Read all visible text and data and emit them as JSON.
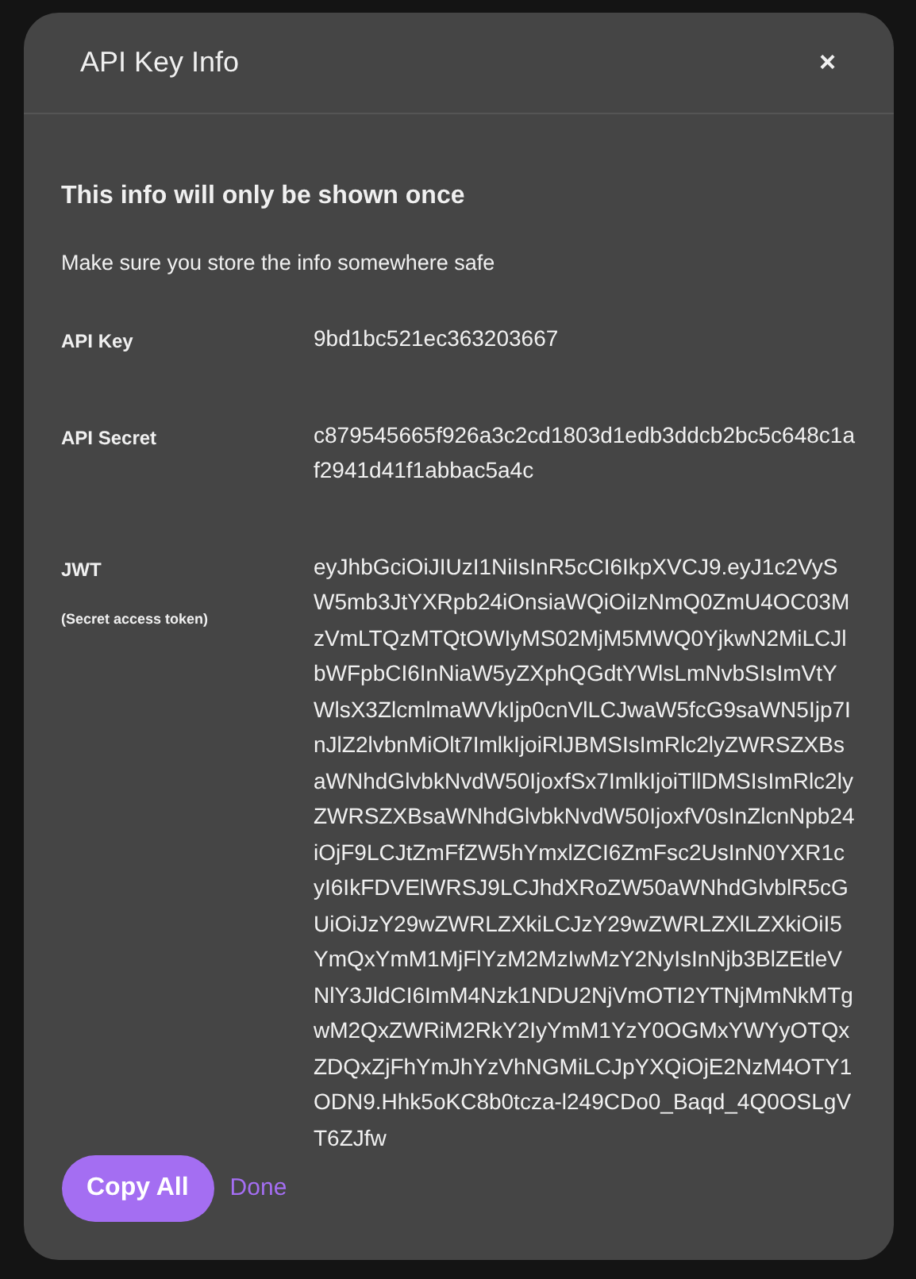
{
  "dialog": {
    "title": "API Key Info",
    "close": "×"
  },
  "heading": "This info will only be shown once",
  "subtitle": "Make sure you store the info somewhere safe",
  "fields": [
    {
      "label": "API Key",
      "value": "9bd1bc521ec363203667"
    },
    {
      "label": "API Secret",
      "value": "c879545665f926a3c2cd1803d1edb3ddcb2bc5c648c1af2941d41f1abbac5a4c"
    },
    {
      "label": "JWT",
      "note": "(Secret access token)",
      "value": "eyJhbGciOiJIUzI1NiIsInR5cCI6IkpXVCJ9.eyJ1c2VySW5mb3JtYXRpb24iOnsiaWQiOiIzNmQ0ZmU4OC03MzVmLTQzMTQtOWIyMS02MjM5MWQ0YjkwN2MiLCJlbWFpbCI6InNiaW5yZXphQGdtYWlsLmNvbSIsImVtYWlsX3ZlcmlmaWVkIjp0cnVlLCJwaW5fcG9saWN5Ijp7InJlZ2lvbnMiOlt7ImlkIjoiRlJBMSIsImRlc2lyZWRSZXBsaWNhdGlvbkNvdW50IjoxfSx7ImlkIjoiTllDMSIsImRlc2lyZWRSZXBsaWNhdGlvbkNvdW50IjoxfV0sInZlcnNpb24iOjF9LCJtZmFfZW5hYmxlZCI6ZmFsc2UsInN0YXR1cyI6IkFDVElWRSJ9LCJhdXRoZW50aWNhdGlvblR5cGUiOiJzY29wZWRLZXkiLCJzY29wZWRLZXlLZXkiOiI5YmQxYmM1MjFlYzM2MzIwMzY2NyIsInNjb3BlZEtleVNlY3JldCI6ImM4Nzk1NDU2NjVmOTI2YTNjMmNkMTgwM2QxZWRiM2RkY2IyYmM1YzY0OGMxYWYyOTQxZDQxZjFhYmJhYzVhNGMiLCJpYXQiOjE2NzM4OTY1ODN9.Hhk5oKC8b0tcza-l249CDo0_Baqd_4Q0OSLgVT6ZJfw"
    }
  ],
  "buttons": [
    {
      "label": "Copy All",
      "kind": "primary"
    },
    {
      "label": "Done",
      "kind": "link"
    }
  ]
}
